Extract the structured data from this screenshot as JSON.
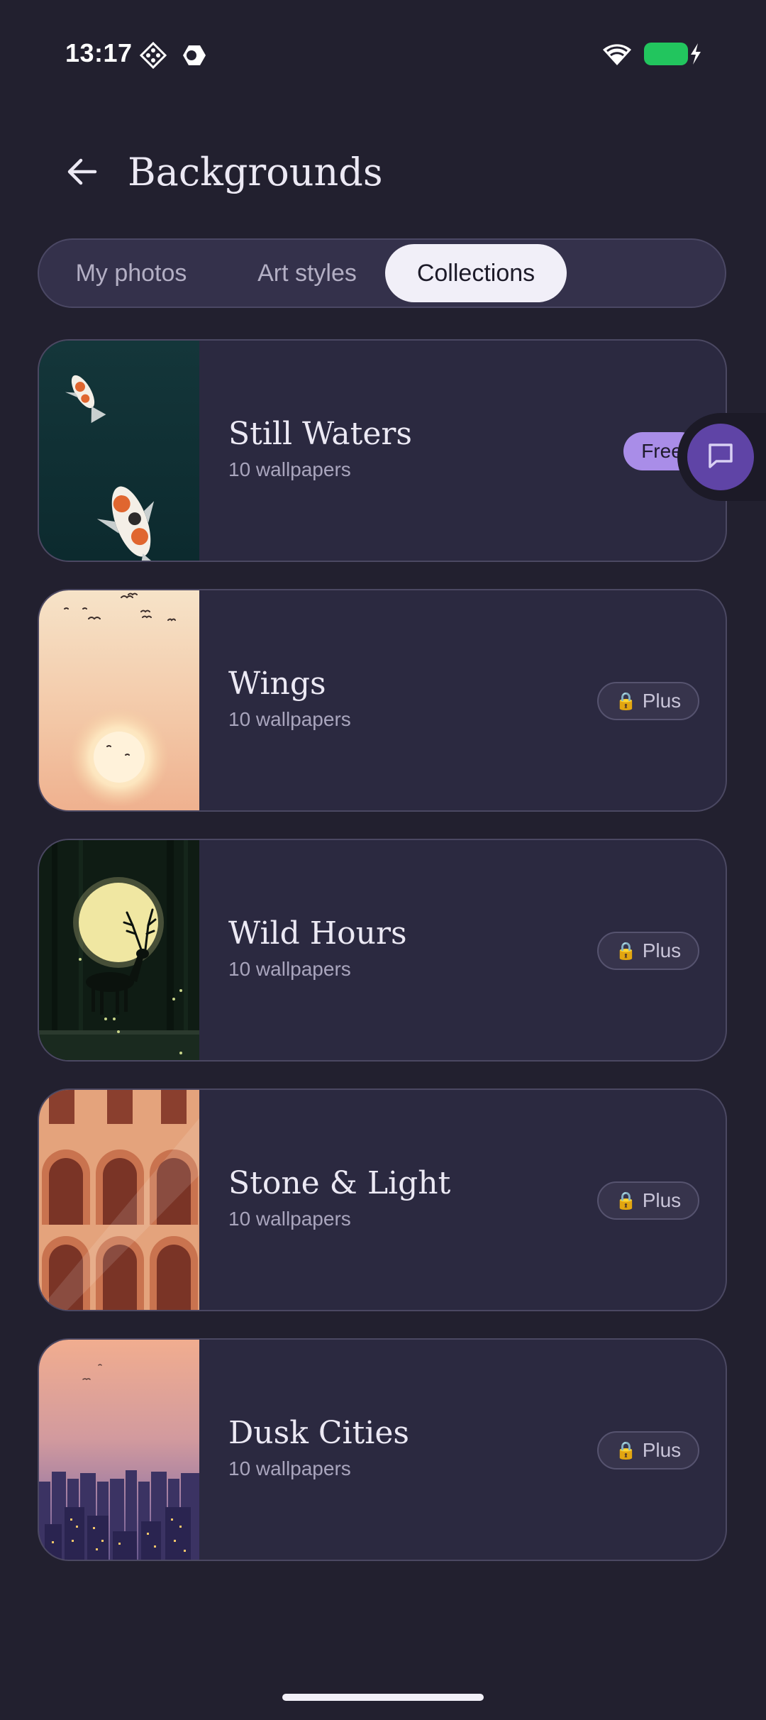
{
  "status_bar": {
    "time": "13:17",
    "icons": [
      "diamond-grid-icon",
      "half-moon-icon",
      "wifi-icon",
      "battery-charging-icon"
    ],
    "battery_color": "#22c55e"
  },
  "header": {
    "back_icon": "arrow-left-icon",
    "title": "Backgrounds"
  },
  "tabs": [
    {
      "label": "My photos",
      "selected": false
    },
    {
      "label": "Art styles",
      "selected": false
    },
    {
      "label": "Collections",
      "selected": true
    }
  ],
  "collections": [
    {
      "title": "Still Waters",
      "subtitle": "10 wallpapers",
      "badge": "Free"
    },
    {
      "title": "Wings",
      "subtitle": "10 wallpapers",
      "badge": "Plus"
    },
    {
      "title": "Wild Hours",
      "subtitle": "10 wallpapers",
      "badge": "Plus"
    },
    {
      "title": "Stone & Light",
      "subtitle": "10 wallpapers",
      "badge": "Plus"
    },
    {
      "title": "Dusk Cities",
      "subtitle": "10 wallpapers",
      "badge": "Plus"
    }
  ],
  "lock_glyph": "🔒",
  "feedback_button": {
    "icon": "chat-bubble-icon"
  },
  "colors": {
    "background": "#22202f",
    "card": "#2b2940",
    "free_badge": "#a98de8",
    "selected_tab": "#f1eff8",
    "fab": "#5f44a6"
  }
}
